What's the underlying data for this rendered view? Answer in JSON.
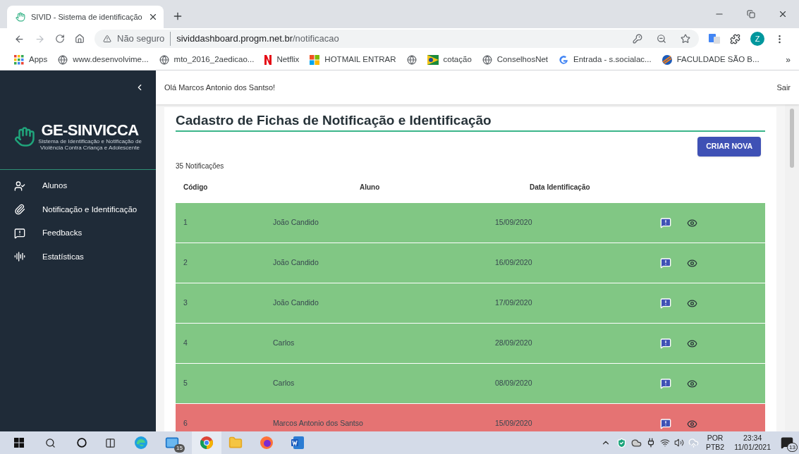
{
  "browser": {
    "tab": {
      "title": "SIVID - Sistema de identificação",
      "selected": true
    },
    "address": {
      "security": "Não seguro",
      "host": "sividdashboard.progm.net.br",
      "path": "/notificacao"
    },
    "profile": "Z",
    "bookmarks": [
      {
        "kind": "apps",
        "label": "Apps"
      },
      {
        "kind": "globe",
        "label": "www.desenvolvime..."
      },
      {
        "kind": "globe",
        "label": "mto_2016_2aedicao..."
      },
      {
        "kind": "netflix",
        "label": "Netflix"
      },
      {
        "kind": "windows",
        "label": "HOTMAIL ENTRAR"
      },
      {
        "kind": "globe"
      },
      {
        "kind": "flag",
        "label": "cotação"
      },
      {
        "kind": "globe",
        "label": "ConselhosNet"
      },
      {
        "kind": "google",
        "label": "Entrada - s.socialac..."
      },
      {
        "kind": "sphere",
        "label": "FACULDADE SÃO B..."
      }
    ],
    "more": "»"
  },
  "sidebar": {
    "logo": {
      "title": "GE-SINVICCA",
      "lines": [
        "Sistema de Identificação e Notificação de",
        "Violência Contra Criança e Adolescente"
      ]
    },
    "items": [
      {
        "label": "Alunos"
      },
      {
        "label": "Notificação e Identificação"
      },
      {
        "label": "Feedbacks"
      },
      {
        "label": "Estatísticas"
      }
    ]
  },
  "header": {
    "greeting": "Olá Marcos Antonio dos Santso!",
    "logout": "Sair"
  },
  "page": {
    "title": "Cadastro de Fichas de Notificação e Identificação",
    "button": "CRIAR NOVA",
    "count": "35 Notificações",
    "columns": [
      "Código",
      "Aluno",
      "Data Identificação"
    ],
    "rows": [
      {
        "code": "1",
        "name": "João Candido",
        "date": "15/09/2020",
        "color": "#81c784"
      },
      {
        "code": "2",
        "name": "João Candido",
        "date": "16/09/2020",
        "color": "#81c784"
      },
      {
        "code": "3",
        "name": "João Candido",
        "date": "17/09/2020",
        "color": "#81c784"
      },
      {
        "code": "4",
        "name": "Carlos",
        "date": "28/09/2020",
        "color": "#81c784"
      },
      {
        "code": "5",
        "name": "Carlos",
        "date": "08/09/2020",
        "color": "#81c784"
      },
      {
        "code": "6",
        "name": "Marcos Antonio dos Santso",
        "date": "15/09/2020",
        "color": "#e57373"
      }
    ]
  },
  "taskbar": {
    "mail_badge": "15",
    "lang": "POR",
    "layout": "PTB2",
    "time": "23:34",
    "date": "11/01/2021",
    "notifications": "13"
  }
}
